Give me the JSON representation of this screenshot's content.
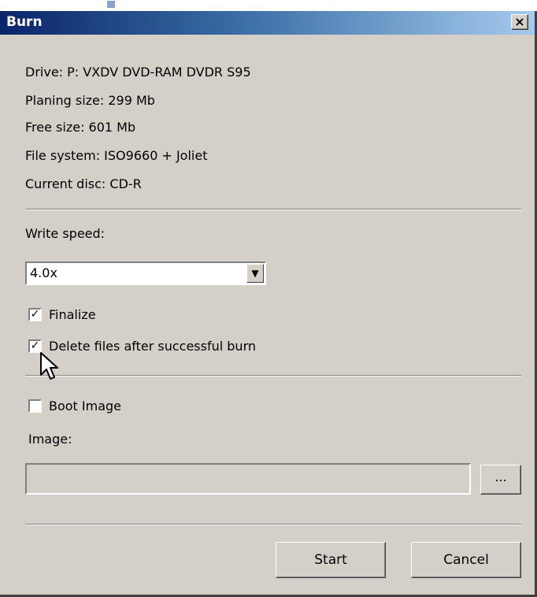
{
  "dialog": {
    "title": "Burn",
    "close_glyph": "×"
  },
  "info": {
    "drive": "Drive: P: VXDV    DVD-RAM DVDR S95",
    "planing_size": "Planing size: 299 Mb",
    "free_size": "Free size: 601 Mb",
    "file_system": "File system: ISO9660 + Joliet",
    "current_disc": "Current disc: CD-R"
  },
  "write_speed": {
    "label": "Write speed:",
    "selected": "4.0x"
  },
  "options": {
    "finalize": {
      "label": "Finalize",
      "checked": true
    },
    "delete_files": {
      "label": "Delete files after successful burn",
      "checked": true
    },
    "boot_image": {
      "label": "Boot Image",
      "checked": false
    }
  },
  "image": {
    "label": "Image:",
    "value": "",
    "browse_label": "..."
  },
  "buttons": {
    "start": "Start",
    "cancel": "Cancel"
  },
  "colors": {
    "face": "#d4d0c8",
    "title_start": "#0a246a",
    "title_end": "#a6caf0"
  }
}
